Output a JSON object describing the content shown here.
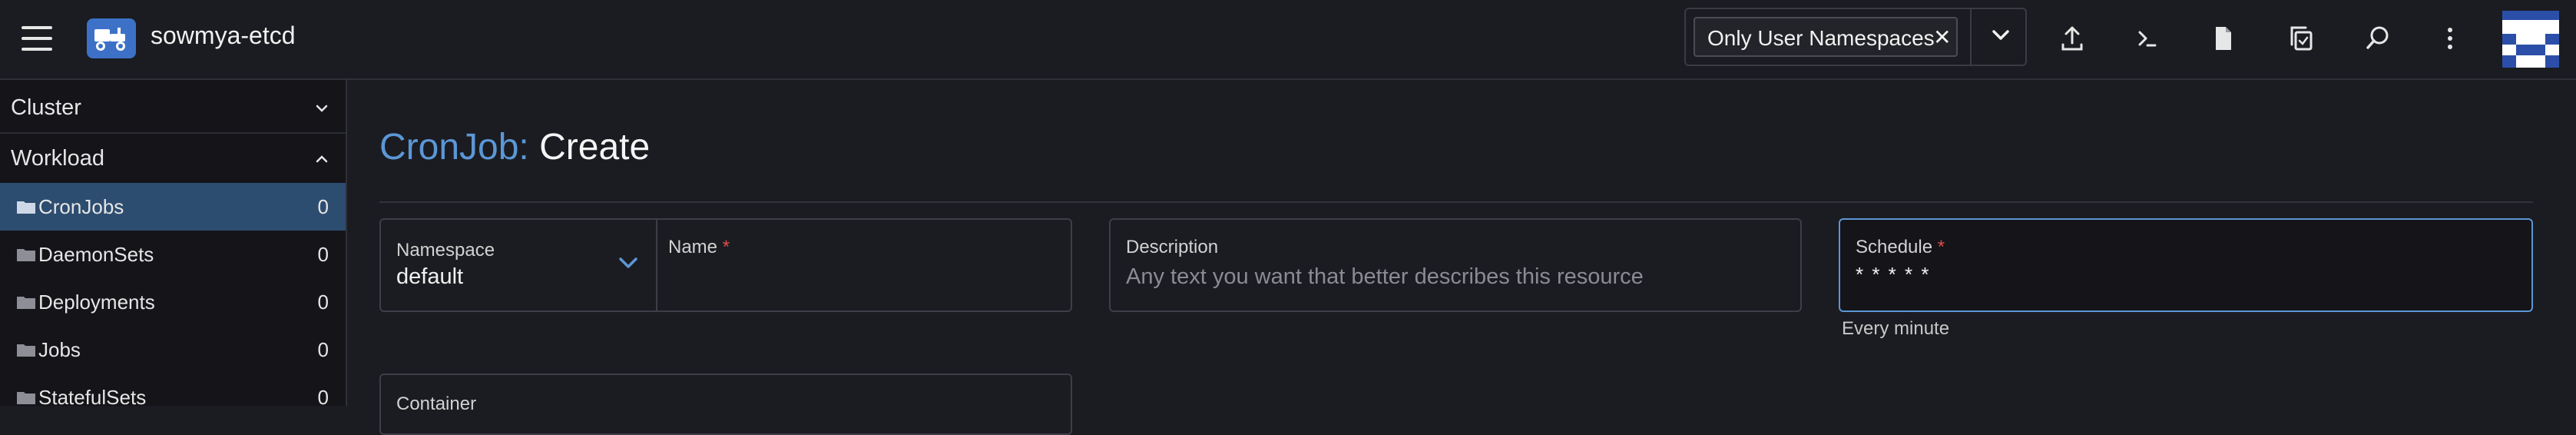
{
  "header": {
    "cluster_name": "sowmya-etcd",
    "namespace_filter": {
      "chip_label": "Only User Namespaces"
    }
  },
  "sidebar": {
    "groups": [
      {
        "label": "Cluster",
        "expanded": false
      },
      {
        "label": "Workload",
        "expanded": true
      }
    ],
    "items": [
      {
        "label": "CronJobs",
        "count": "0",
        "active": true
      },
      {
        "label": "DaemonSets",
        "count": "0"
      },
      {
        "label": "Deployments",
        "count": "0"
      },
      {
        "label": "Jobs",
        "count": "0"
      },
      {
        "label": "StatefulSets",
        "count": "0"
      }
    ]
  },
  "main": {
    "title_kind": "CronJob:",
    "title_verb": "Create",
    "namespace": {
      "label": "Namespace",
      "value": "default"
    },
    "name": {
      "label": "Name",
      "required_mark": "*"
    },
    "description": {
      "label": "Description",
      "placeholder": "Any text you want that better describes this resource"
    },
    "schedule": {
      "label": "Schedule",
      "required_mark": "*",
      "value": "* * * * *",
      "help": "Every minute"
    },
    "container": {
      "label": "Container"
    }
  },
  "colors": {
    "accent": "#5b97d6",
    "active_row": "#2d4d70",
    "background": "#1b1c21"
  }
}
